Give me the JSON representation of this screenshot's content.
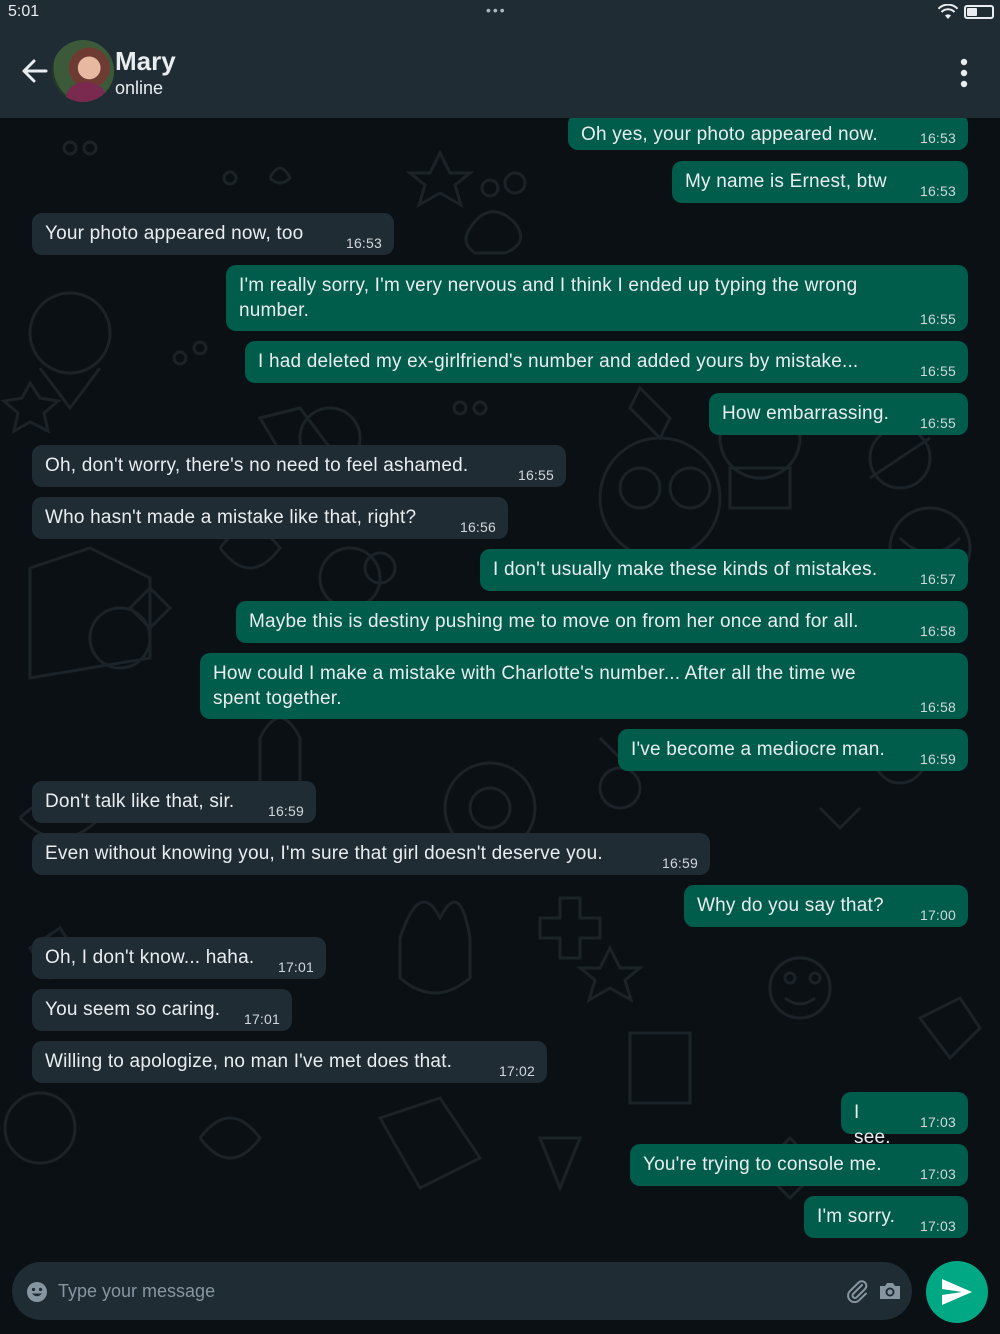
{
  "status_bar": {
    "time": "5:01",
    "dots": "•••"
  },
  "header": {
    "contact_name": "Mary",
    "contact_status": "online"
  },
  "messages": [
    {
      "dir": "out",
      "text": "Oh yes, your photo appeared now.",
      "time": "16:53"
    },
    {
      "dir": "out",
      "text": "My name is Ernest, btw",
      "time": "16:53"
    },
    {
      "dir": "in",
      "text": "Your photo appeared now, too",
      "time": "16:53"
    },
    {
      "dir": "out",
      "text": "I'm really sorry, I'm very nervous and I think I ended up typing the wrong number.",
      "time": "16:55"
    },
    {
      "dir": "out",
      "text": "I had deleted my ex-girlfriend's number and added yours by mistake...",
      "time": "16:55"
    },
    {
      "dir": "out",
      "text": "How embarrassing.",
      "time": "16:55"
    },
    {
      "dir": "in",
      "text": "Oh, don't worry, there's no need to feel ashamed.",
      "time": "16:55"
    },
    {
      "dir": "in",
      "text": "Who hasn't made a mistake like that, right?",
      "time": "16:56"
    },
    {
      "dir": "out",
      "text": "I don't usually make these kinds of mistakes.",
      "time": "16:57"
    },
    {
      "dir": "out",
      "text": "Maybe this is destiny pushing me to move on from her once and for all.",
      "time": "16:58"
    },
    {
      "dir": "out",
      "text": "How could I make a mistake with Charlotte's number... After all the time we spent together.",
      "time": "16:58"
    },
    {
      "dir": "out",
      "text": "I've become a mediocre man.",
      "time": "16:59"
    },
    {
      "dir": "in",
      "text": "Don't talk like that, sir.",
      "time": "16:59"
    },
    {
      "dir": "in",
      "text": "Even without knowing you, I'm sure that girl doesn't deserve you.",
      "time": "16:59"
    },
    {
      "dir": "out",
      "text": "Why do you say that?",
      "time": "17:00"
    },
    {
      "dir": "in",
      "text": "Oh, I don't know... haha.",
      "time": "17:01"
    },
    {
      "dir": "in",
      "text": "You seem so caring.",
      "time": "17:01"
    },
    {
      "dir": "in",
      "text": "Willing to apologize, no man I've met does that.",
      "time": "17:02"
    },
    {
      "dir": "out",
      "text": "I see.",
      "time": "17:03"
    },
    {
      "dir": "out",
      "text": "You're trying to console me.",
      "time": "17:03"
    },
    {
      "dir": "out",
      "text": "I'm sorry.",
      "time": "17:03"
    }
  ],
  "composer": {
    "placeholder": "Type your message",
    "value": ""
  },
  "colors": {
    "header": "#1f2c34",
    "outgoing": "#005c4b",
    "incoming": "#1f2c34",
    "accent": "#00a884",
    "background": "#0b1014"
  },
  "icons": [
    "back-arrow-icon",
    "more-vert-icon",
    "emoji-icon",
    "attach-icon",
    "camera-icon",
    "send-icon",
    "wifi-icon",
    "battery-icon"
  ]
}
